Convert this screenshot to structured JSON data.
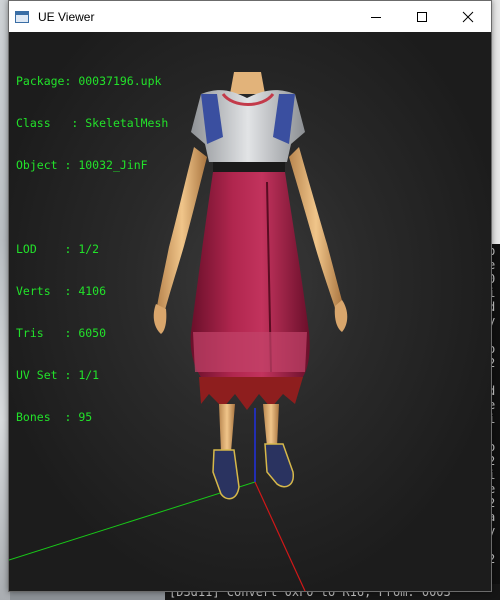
{
  "window": {
    "title": "UE Viewer",
    "buttons": {
      "minimize": "minimize-icon",
      "maximize": "maximize-icon",
      "close": "close-icon"
    }
  },
  "info": {
    "package_label": "Package",
    "package": "00037196.upk",
    "class_label": "Class",
    "class": "SkeletalMesh",
    "object_label": "Object",
    "object": "10032_JinF",
    "lod_label": "LOD",
    "lod": "1/2",
    "verts_label": "Verts",
    "verts": "4106",
    "tris_label": "Tris",
    "tris": "6050",
    "uvset_label": "UV Set",
    "uvset": "1/1",
    "bones_label": "Bones",
    "bones": "95"
  },
  "background": {
    "console_bottom": "[D3d11] Convert 0xF0 to R16, From: 0003"
  },
  "colors": {
    "info_text": "#22e22a",
    "axis_x": "#d01818",
    "axis_y": "#18c818",
    "axis_z": "#2030e0"
  }
}
